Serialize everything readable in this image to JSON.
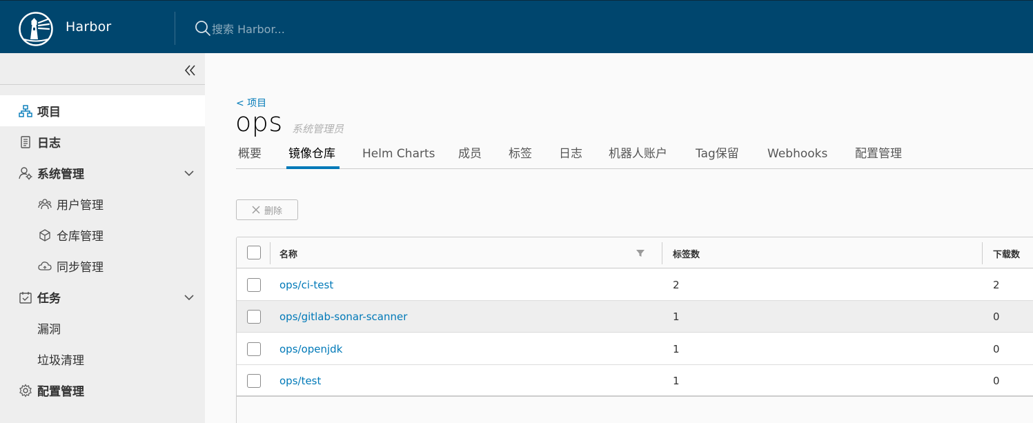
{
  "header": {
    "brand": "Harbor",
    "search_placeholder": "搜索 Harbor..."
  },
  "sidebar": {
    "items": [
      {
        "label": "项目",
        "icon": "projects-icon"
      },
      {
        "label": "日志",
        "icon": "logs-icon"
      },
      {
        "label": "系统管理",
        "icon": "admin-icon"
      },
      {
        "label": "用户管理",
        "icon": "users-icon"
      },
      {
        "label": "仓库管理",
        "icon": "registry-icon"
      },
      {
        "label": "同步管理",
        "icon": "replication-icon"
      },
      {
        "label": "任务",
        "icon": "tasks-icon"
      },
      {
        "label": "漏洞",
        "icon": ""
      },
      {
        "label": "垃圾清理",
        "icon": ""
      },
      {
        "label": "配置管理",
        "icon": "gear-icon"
      }
    ]
  },
  "main": {
    "back_link": "< 项目",
    "project_name": "ops",
    "project_role": "系统管理员",
    "tabs": [
      "概要",
      "镜像仓库",
      "Helm Charts",
      "成员",
      "标签",
      "日志",
      "机器人账户",
      "Tag保留",
      "Webhooks",
      "配置管理"
    ],
    "active_tab": "镜像仓库",
    "delete_label": "删除"
  },
  "table": {
    "columns": [
      "名称",
      "标签数",
      "下载数"
    ],
    "rows": [
      {
        "name": "ops/ci-test",
        "tags": "2",
        "pulls": "2"
      },
      {
        "name": "ops/gitlab-sonar-scanner",
        "tags": "1",
        "pulls": "0"
      },
      {
        "name": "ops/openjdk",
        "tags": "1",
        "pulls": "0"
      },
      {
        "name": "ops/test",
        "tags": "1",
        "pulls": "0"
      }
    ]
  },
  "colors": {
    "header_bg": "#00466e",
    "link": "#0079b8",
    "sidebar_bg": "#eeeeee"
  }
}
